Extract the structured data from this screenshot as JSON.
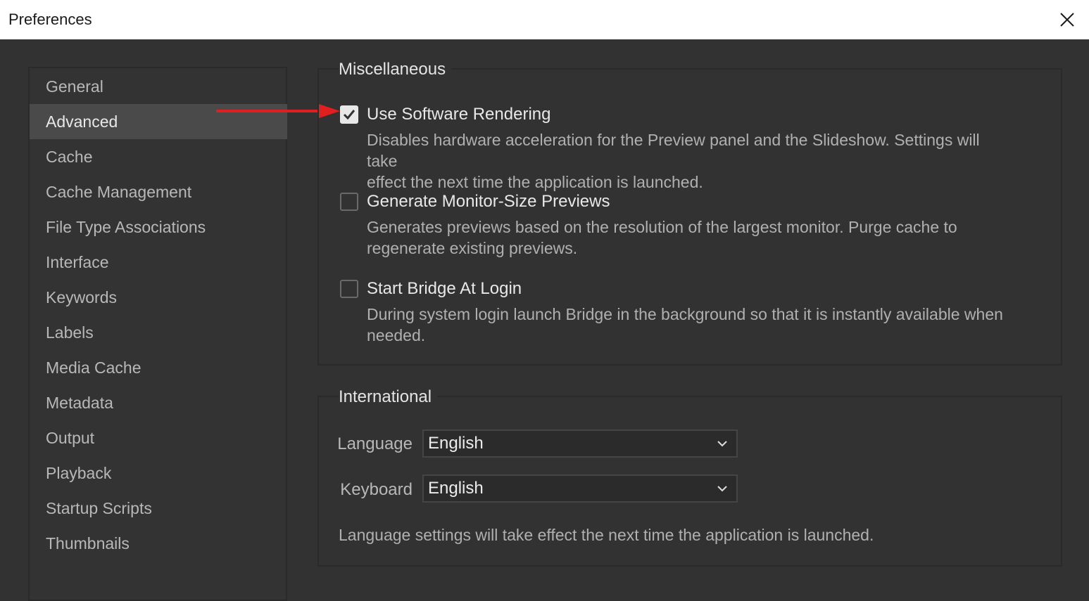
{
  "window": {
    "title": "Preferences"
  },
  "sidebar": {
    "items": [
      {
        "label": "General"
      },
      {
        "label": "Advanced",
        "selected": true
      },
      {
        "label": "Cache"
      },
      {
        "label": "Cache Management"
      },
      {
        "label": "File Type Associations"
      },
      {
        "label": "Interface"
      },
      {
        "label": "Keywords"
      },
      {
        "label": "Labels"
      },
      {
        "label": "Media Cache"
      },
      {
        "label": "Metadata"
      },
      {
        "label": "Output"
      },
      {
        "label": "Playback"
      },
      {
        "label": "Startup Scripts"
      },
      {
        "label": "Thumbnails"
      }
    ]
  },
  "misc": {
    "legend": "Miscellaneous",
    "options": [
      {
        "label": "Use Software Rendering",
        "checked": true,
        "desc_line1": "Disables hardware acceleration for the Preview panel and the Slideshow. Settings will take",
        "desc_line2": "effect the next time the application is launched."
      },
      {
        "label": "Generate Monitor-Size Previews",
        "checked": false,
        "desc_line1": "Generates previews based on the resolution of the largest monitor. Purge cache to",
        "desc_line2": "regenerate existing previews."
      },
      {
        "label": "Start Bridge At Login",
        "checked": false,
        "desc_line1": "During system login launch Bridge in the background so that it is instantly available when",
        "desc_line2": "needed."
      }
    ]
  },
  "international": {
    "legend": "International",
    "language_label": "Language",
    "language_value": "English",
    "keyboard_label": "Keyboard",
    "keyboard_value": "English",
    "note": "Language settings will take effect the next time the application is launched."
  },
  "colors": {
    "background": "#323232",
    "selected_item": "#4a4a4a",
    "annotation_arrow": "#e02020"
  }
}
